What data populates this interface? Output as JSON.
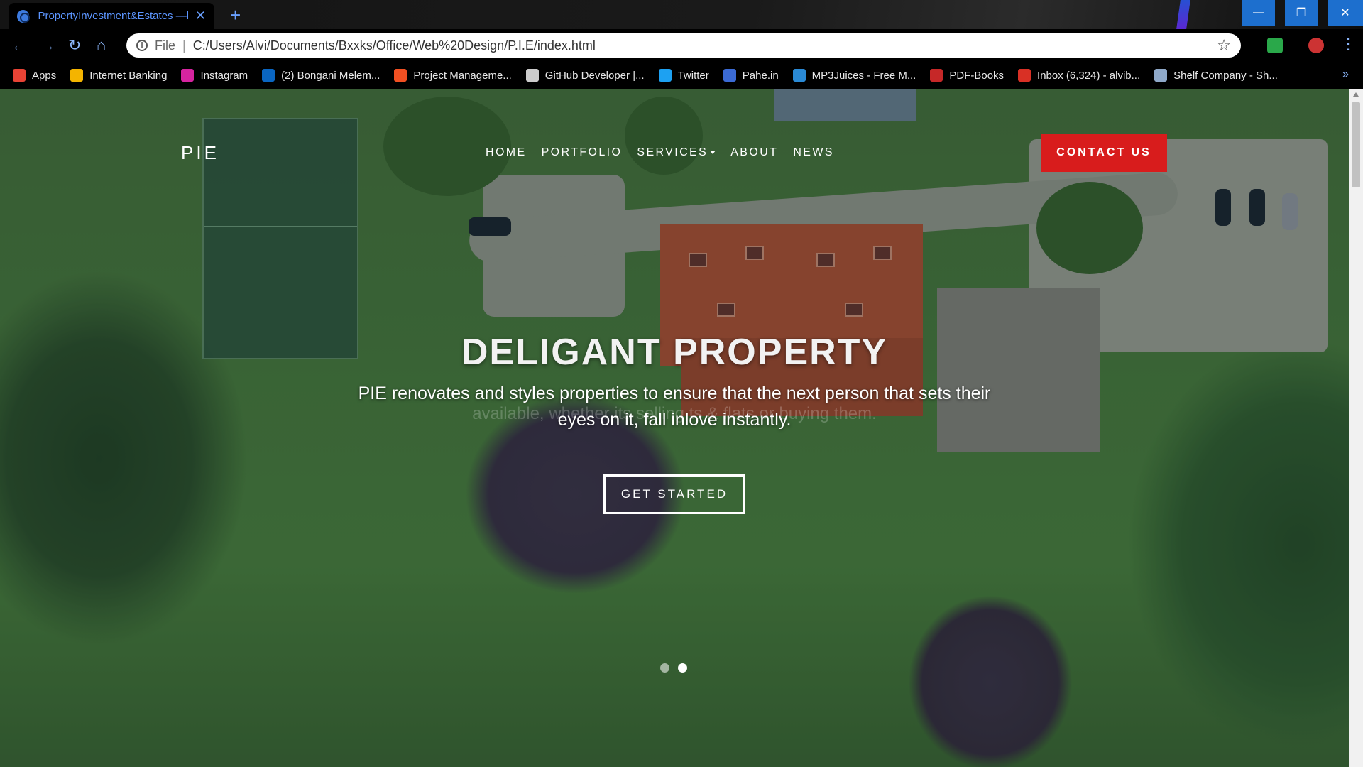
{
  "browser": {
    "tab_title": "PropertyInvestment&Estates —h",
    "url_scheme": "File",
    "url": "C:/Users/Alvi/Documents/Bxxks/Office/Web%20Design/P.I.E/index.html"
  },
  "bookmarks": [
    {
      "label": "Apps",
      "icon": "apps-grid-icon",
      "color": "#e94335"
    },
    {
      "label": "Internet Banking",
      "icon": "bank-icon",
      "color": "#f4b400"
    },
    {
      "label": "Instagram",
      "icon": "instagram-icon",
      "color": "#d6249f"
    },
    {
      "label": "(2) Bongani Melem...",
      "icon": "linkedin-icon",
      "color": "#0a66c2"
    },
    {
      "label": "Project Manageme...",
      "icon": "microsoft-icon",
      "color": "#f25022"
    },
    {
      "label": "GitHub Developer |...",
      "icon": "github-icon",
      "color": "#cccccc"
    },
    {
      "label": "Twitter",
      "icon": "twitter-icon",
      "color": "#1da1f2"
    },
    {
      "label": "Pahe.in",
      "icon": "pahe-icon",
      "color": "#3b6bd6"
    },
    {
      "label": "MP3Juices - Free M...",
      "icon": "download-icon",
      "color": "#2a8ad6"
    },
    {
      "label": "PDF-Books",
      "icon": "pdf-icon",
      "color": "#c62828"
    },
    {
      "label": "Inbox (6,324) - alvib...",
      "icon": "gmail-icon",
      "color": "#d93025"
    },
    {
      "label": "Shelf Company - Sh...",
      "icon": "document-icon",
      "color": "#8fa9c9"
    }
  ],
  "site": {
    "logo": "PIE",
    "nav": [
      "HOME",
      "PORTFOLIO",
      "SERVICES",
      "ABOUT",
      "NEWS"
    ],
    "contact_label": "CONTACT US",
    "hero_title": "DELIGANT PROPERTY",
    "hero_subtitle": "PIE renovates and styles properties to ensure that the next person that sets their eyes on it, fall inlove instantly.",
    "hero_ghost_text": "available, whether its selling                                                    ts & flats or buying them.",
    "cta_label": "GET STARTED",
    "slides": 2,
    "active_slide": 2
  },
  "colors": {
    "accent_red": "#d81c1c",
    "tab_blue": "#5c95ff",
    "window_controls": "#1d6fce"
  }
}
